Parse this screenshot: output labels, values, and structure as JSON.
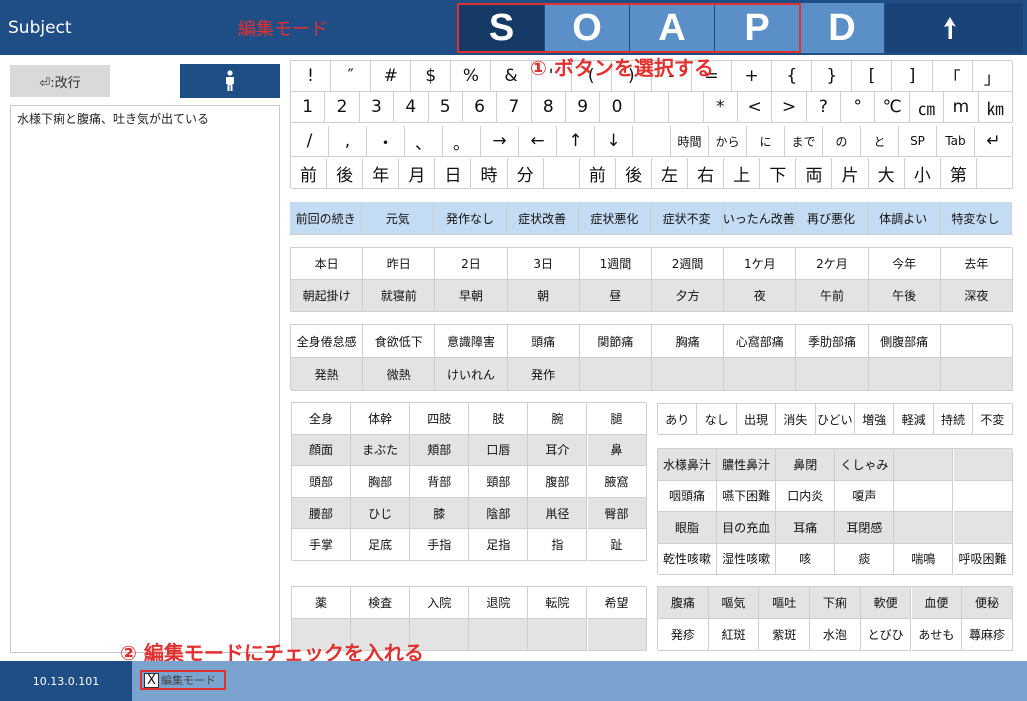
{
  "header": {
    "title": "Subject",
    "mode": "編集モード"
  },
  "soapd": [
    "S",
    "O",
    "A",
    "P",
    "D"
  ],
  "back_icon": "return-arrow-icon",
  "annotations": {
    "a1": "① ボタンを選択する",
    "a2": "② 編集モードにチェックを入れる"
  },
  "left": {
    "newline_label": "⏎:改行",
    "person_icon": "person-icon",
    "text": "水様下痢と腹痛、吐き気が出ている"
  },
  "keys": {
    "row1": [
      "!",
      "″",
      "#",
      "$",
      "%",
      "&",
      "'",
      "(",
      ")",
      "-",
      "=",
      "+",
      "{",
      "}",
      "[",
      "]",
      "「",
      "」"
    ],
    "row2": [
      "1",
      "2",
      "3",
      "4",
      "5",
      "6",
      "7",
      "8",
      "9",
      "0",
      "",
      "",
      "*",
      "<",
      ">",
      "?",
      "°",
      "℃",
      "㎝",
      "m",
      "㎞"
    ],
    "row3": [
      "/",
      ",",
      "・",
      "、",
      "。",
      "→",
      "←",
      "↑",
      "↓",
      "",
      "時間",
      "から",
      "に",
      "まで",
      "の",
      "と",
      "SP",
      "Tab",
      "↵"
    ],
    "row4": [
      "前",
      "後",
      "年",
      "月",
      "日",
      "時",
      "分",
      "",
      "前",
      "後",
      "左",
      "右",
      "上",
      "下",
      "両",
      "片",
      "大",
      "小",
      "第",
      ""
    ]
  },
  "course": [
    "前回の続き",
    "元気",
    "発作なし",
    "症状改善",
    "症状悪化",
    "症状不変",
    "いったん改善",
    "再び悪化",
    "体調よい",
    "特変なし"
  ],
  "time_rows": [
    [
      "本日",
      "昨日",
      "2日",
      "3日",
      "1週間",
      "2週間",
      "1ケ月",
      "2ケ月",
      "今年",
      "去年"
    ],
    [
      "朝起掛け",
      "就寝前",
      "早朝",
      "朝",
      "昼",
      "夕方",
      "夜",
      "午前",
      "午後",
      "深夜"
    ]
  ],
  "symptom_rows": [
    [
      "全身倦怠感",
      "食欲低下",
      "意識障害",
      "頭痛",
      "関節痛",
      "胸痛",
      "心窩部痛",
      "季肋部痛",
      "側腹部痛",
      ""
    ],
    [
      "発熱",
      "微熱",
      "けいれん",
      "発作",
      "",
      "",
      "",
      "",
      "",
      ""
    ]
  ],
  "body_rows": [
    [
      "全身",
      "体幹",
      "四肢",
      "肢",
      "腕",
      "腿"
    ],
    [
      "顔面",
      "まぶた",
      "頬部",
      "口唇",
      "耳介",
      "鼻"
    ],
    [
      "頭部",
      "胸部",
      "背部",
      "頸部",
      "腹部",
      "腋窩"
    ],
    [
      "腰部",
      "ひじ",
      "膝",
      "陰部",
      "鼡径",
      "臀部"
    ],
    [
      "手掌",
      "足底",
      "手指",
      "足指",
      "指",
      "趾"
    ]
  ],
  "state_row": [
    "あり",
    "なし",
    "出現",
    "消失",
    "ひどい",
    "増強",
    "軽減",
    "持続",
    "不変"
  ],
  "resp_rows": [
    [
      "水様鼻汁",
      "膿性鼻汁",
      "鼻閉",
      "くしゃみ",
      "",
      ""
    ],
    [
      "咽頭痛",
      "嚥下困難",
      "口内炎",
      "嗄声",
      "",
      ""
    ],
    [
      "眼脂",
      "目の充血",
      "耳痛",
      "耳閉感",
      "",
      ""
    ],
    [
      "乾性咳嗽",
      "湿性咳嗽",
      "咳",
      "痰",
      "喘鳴",
      "呼吸困難"
    ]
  ],
  "med_rows": [
    [
      "薬",
      "検査",
      "入院",
      "退院",
      "転院",
      "希望"
    ],
    [
      "",
      "",
      "",
      "",
      "",
      ""
    ]
  ],
  "gi_rows": [
    [
      "腹痛",
      "嘔気",
      "嘔吐",
      "下痢",
      "軟便",
      "血便",
      "便秘"
    ],
    [
      "発疹",
      "紅斑",
      "紫斑",
      "水泡",
      "とびひ",
      "あせも",
      "蕁麻疹"
    ]
  ],
  "footer": {
    "version": "10.13.0.101",
    "edit_check": "X",
    "edit_label": "編集モード"
  }
}
